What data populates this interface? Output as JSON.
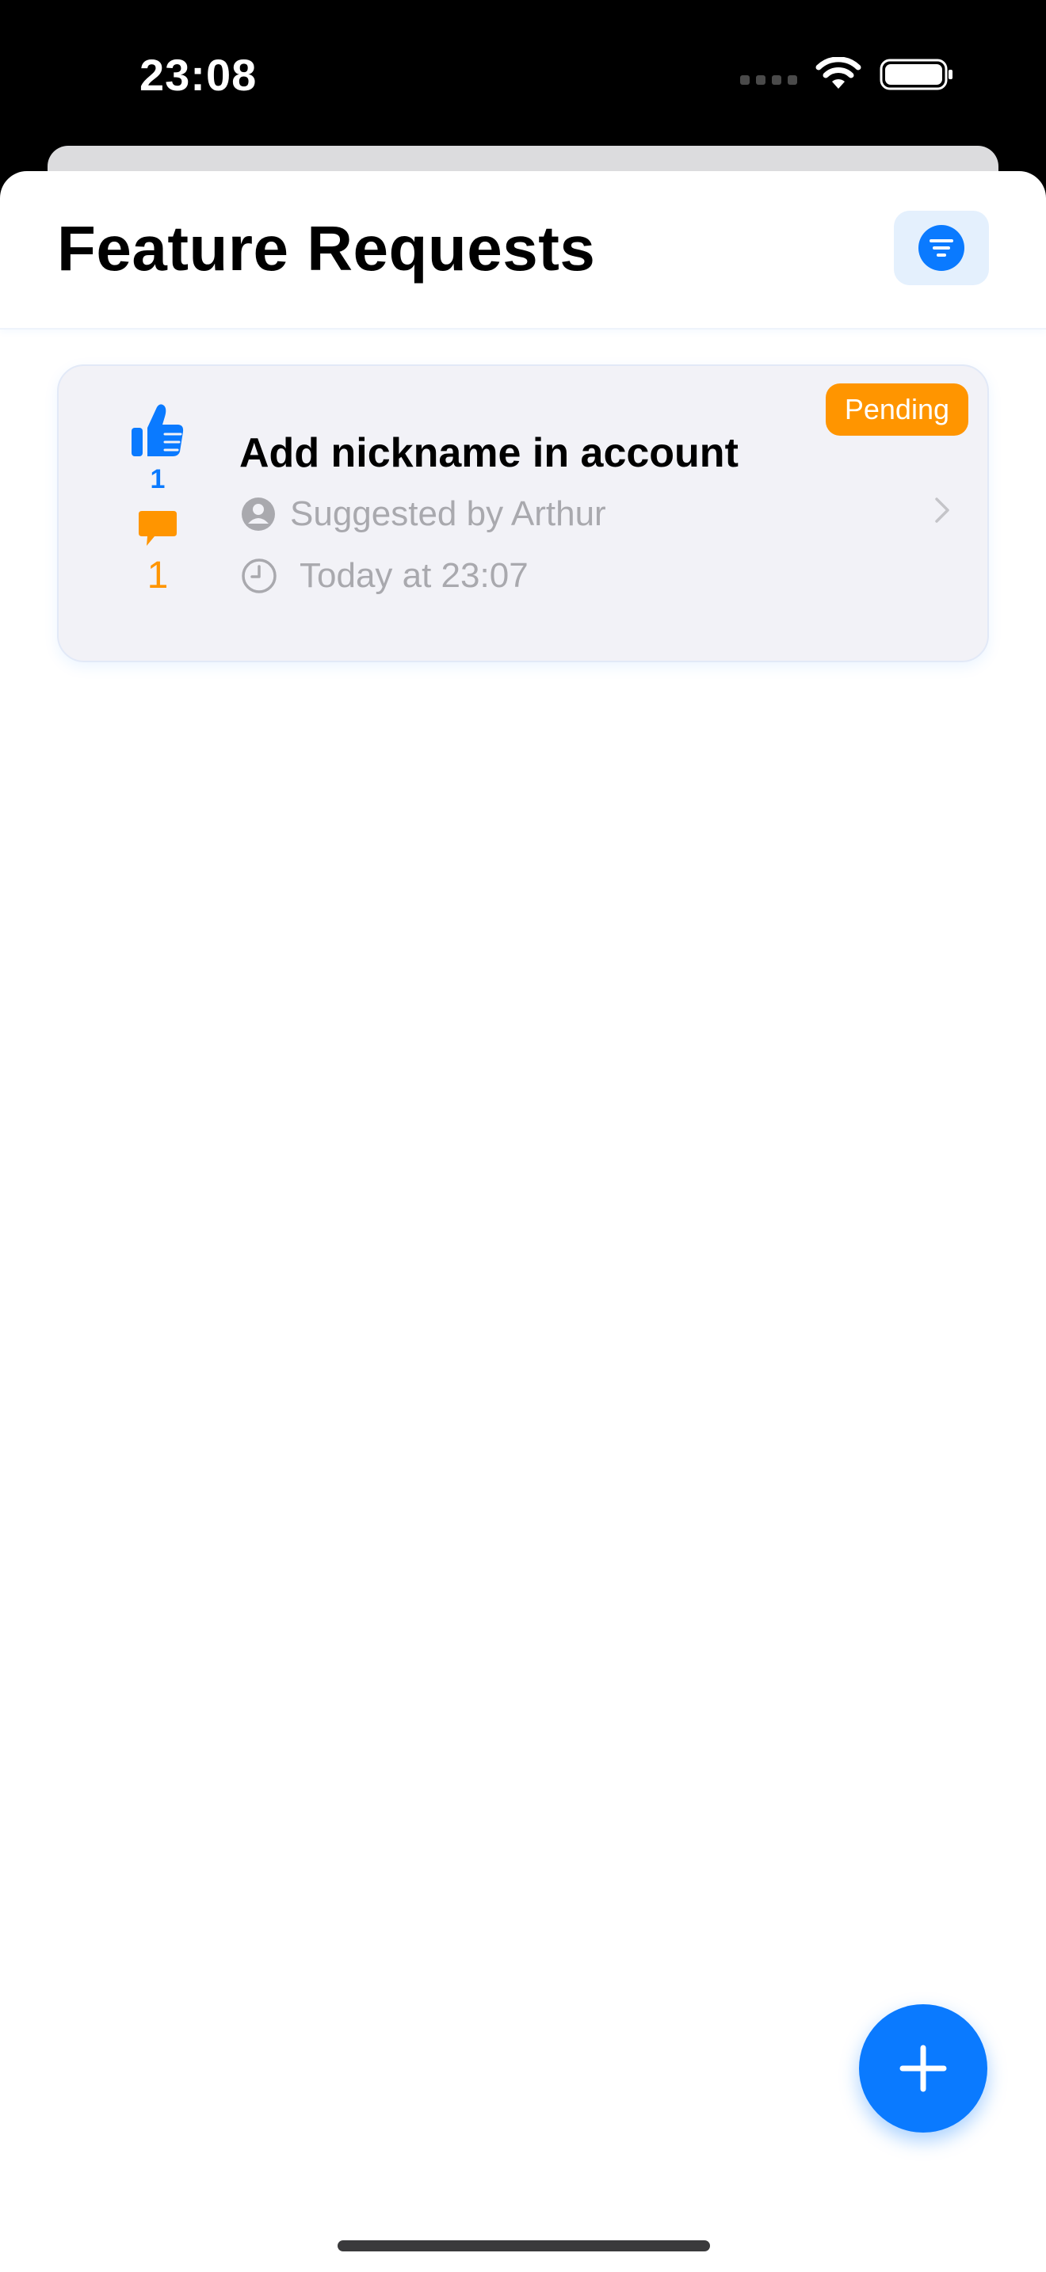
{
  "status_bar": {
    "time": "23:08",
    "icons": [
      "cellular-dots-icon",
      "wifi-icon",
      "battery-icon"
    ]
  },
  "header": {
    "title": "Feature Requests",
    "filter_icon": "filter-icon"
  },
  "requests": [
    {
      "title": "Add nickname in account",
      "status": "Pending",
      "votes": "1",
      "comments": "1",
      "author": "Suggested by Arthur",
      "date": "Today at 23:07"
    }
  ],
  "fab": {
    "icon": "plus-icon"
  },
  "colors": {
    "accent": "#0a7aff",
    "pending": "#ff9500",
    "card_background": "#f2f2f7",
    "meta_text": "#a9a9ae"
  }
}
